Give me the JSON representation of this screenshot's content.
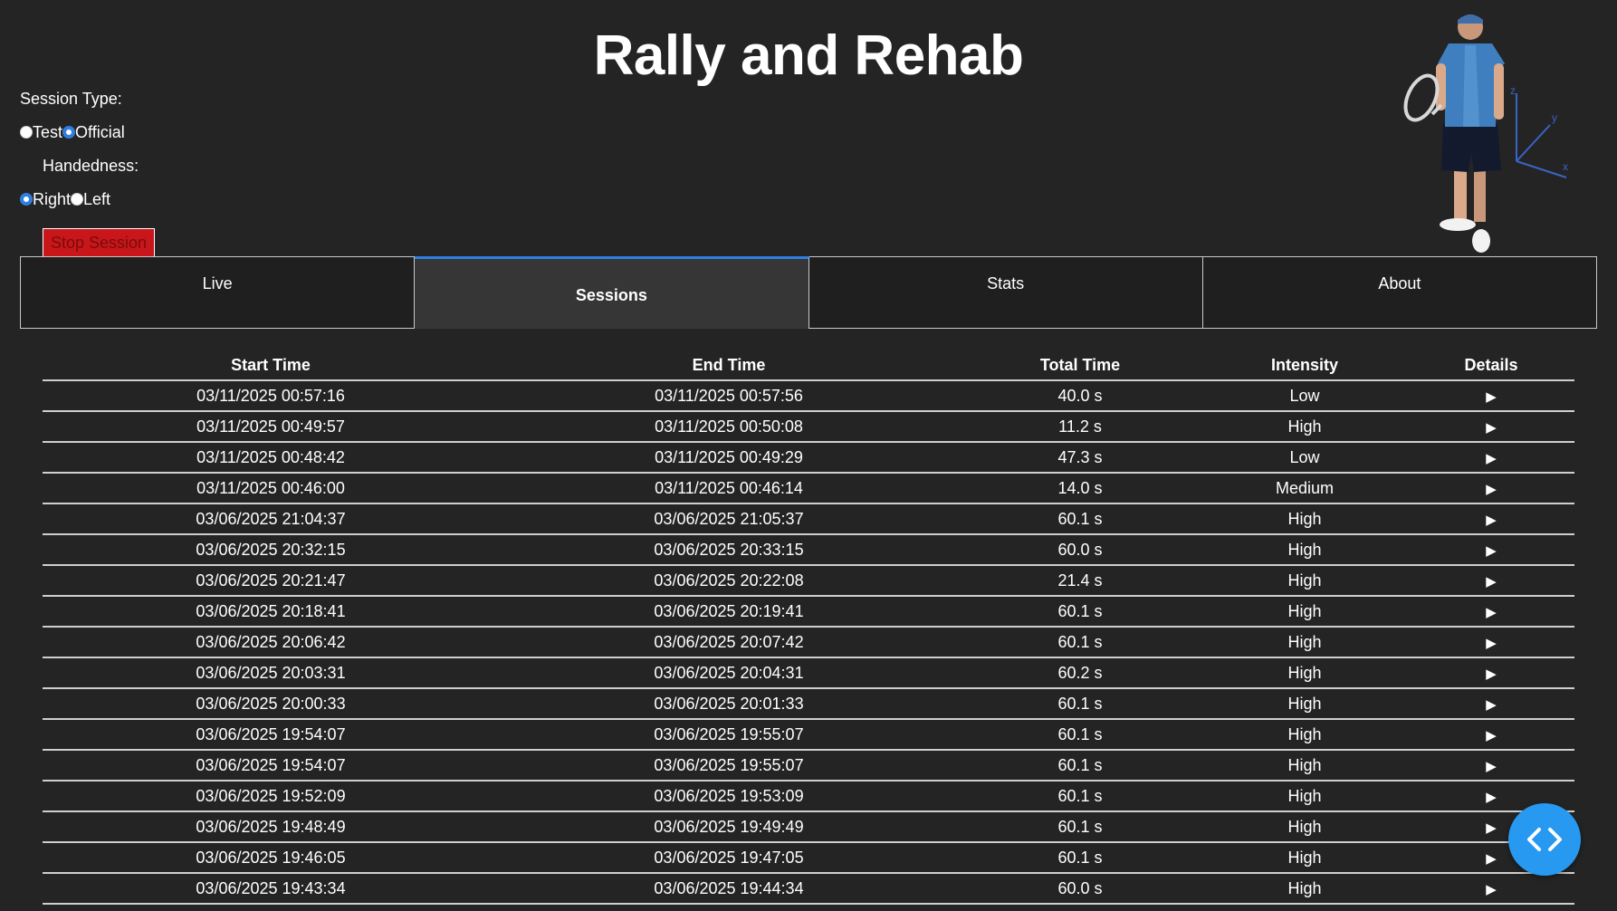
{
  "header": {
    "title": "Rally and Rehab"
  },
  "controls": {
    "session_type_label": "Session Type:",
    "session_type_options": [
      {
        "label": "Test",
        "checked": false
      },
      {
        "label": "Official",
        "checked": true
      }
    ],
    "handedness_label": "Handedness:",
    "handedness_options": [
      {
        "label": "Right",
        "checked": true
      },
      {
        "label": "Left",
        "checked": false
      }
    ],
    "stop_button_label": "Stop Session"
  },
  "player_graphic": {
    "axis_labels": [
      "z",
      "y",
      "x"
    ],
    "shirt_color": "#3f7fbf",
    "shorts_color": "#141a2e"
  },
  "tabs": [
    {
      "label": "Live",
      "active": false
    },
    {
      "label": "Sessions",
      "active": true
    },
    {
      "label": "Stats",
      "active": false
    },
    {
      "label": "About",
      "active": false
    }
  ],
  "sessions_table": {
    "columns": [
      "Start Time",
      "End Time",
      "Total Time",
      "Intensity",
      "Details"
    ],
    "details_glyph": "▶",
    "rows": [
      {
        "start": "03/11/2025 00:57:16",
        "end": "03/11/2025 00:57:56",
        "total": "40.0 s",
        "intensity": "Low"
      },
      {
        "start": "03/11/2025 00:49:57",
        "end": "03/11/2025 00:50:08",
        "total": "11.2 s",
        "intensity": "High"
      },
      {
        "start": "03/11/2025 00:48:42",
        "end": "03/11/2025 00:49:29",
        "total": "47.3 s",
        "intensity": "Low"
      },
      {
        "start": "03/11/2025 00:46:00",
        "end": "03/11/2025 00:46:14",
        "total": "14.0 s",
        "intensity": "Medium"
      },
      {
        "start": "03/06/2025 21:04:37",
        "end": "03/06/2025 21:05:37",
        "total": "60.1 s",
        "intensity": "High"
      },
      {
        "start": "03/06/2025 20:32:15",
        "end": "03/06/2025 20:33:15",
        "total": "60.0 s",
        "intensity": "High"
      },
      {
        "start": "03/06/2025 20:21:47",
        "end": "03/06/2025 20:22:08",
        "total": "21.4 s",
        "intensity": "High"
      },
      {
        "start": "03/06/2025 20:18:41",
        "end": "03/06/2025 20:19:41",
        "total": "60.1 s",
        "intensity": "High"
      },
      {
        "start": "03/06/2025 20:06:42",
        "end": "03/06/2025 20:07:42",
        "total": "60.1 s",
        "intensity": "High"
      },
      {
        "start": "03/06/2025 20:03:31",
        "end": "03/06/2025 20:04:31",
        "total": "60.2 s",
        "intensity": "High"
      },
      {
        "start": "03/06/2025 20:00:33",
        "end": "03/06/2025 20:01:33",
        "total": "60.1 s",
        "intensity": "High"
      },
      {
        "start": "03/06/2025 19:54:07",
        "end": "03/06/2025 19:55:07",
        "total": "60.1 s",
        "intensity": "High"
      },
      {
        "start": "03/06/2025 19:54:07",
        "end": "03/06/2025 19:55:07",
        "total": "60.1 s",
        "intensity": "High"
      },
      {
        "start": "03/06/2025 19:52:09",
        "end": "03/06/2025 19:53:09",
        "total": "60.1 s",
        "intensity": "High"
      },
      {
        "start": "03/06/2025 19:48:49",
        "end": "03/06/2025 19:49:49",
        "total": "60.1 s",
        "intensity": "High"
      },
      {
        "start": "03/06/2025 19:46:05",
        "end": "03/06/2025 19:47:05",
        "total": "60.1 s",
        "intensity": "High"
      },
      {
        "start": "03/06/2025 19:43:34",
        "end": "03/06/2025 19:44:34",
        "total": "60.0 s",
        "intensity": "High"
      }
    ]
  },
  "fab": {
    "icon": "code-brackets-icon",
    "color": "#2799f0"
  }
}
